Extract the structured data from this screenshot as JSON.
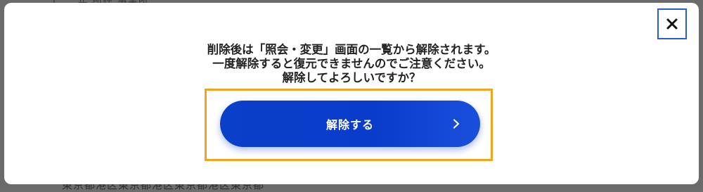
{
  "background": {
    "top_text": "〒 … 年 所在 事業所",
    "bottom_text": "東京都港区東京都港区東京都港区東京都"
  },
  "modal": {
    "close_icon": "close-icon",
    "message_lines": [
      "削除後は「照会・変更」画面の一覧から解除されます。",
      "一度解除すると復元できませんのでご注意ください。",
      "解除してよろしいですか？"
    ],
    "confirm_button": {
      "label": "解除する",
      "icon": "chevron-right-icon"
    },
    "colors": {
      "button": "#0a3ccc",
      "highlight": "#f0a51e",
      "close_border": "#2a5cd8"
    }
  }
}
